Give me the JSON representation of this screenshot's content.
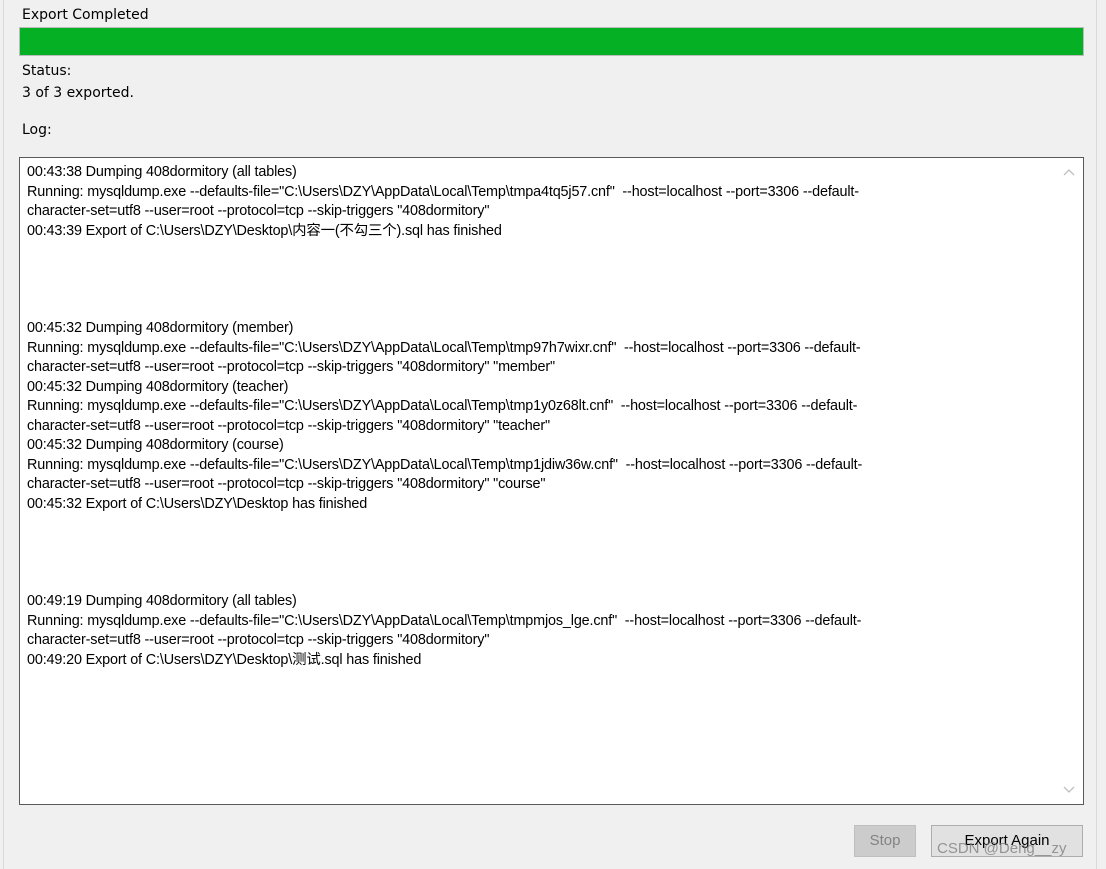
{
  "header": {
    "title": "Export Completed"
  },
  "progress": {
    "fraction": 1.0,
    "color": "#06b025"
  },
  "status": {
    "label": "Status:",
    "value": "3 of 3 exported."
  },
  "log": {
    "label": "Log:",
    "text": "00:43:38 Dumping 408dormitory (all tables)\nRunning: mysqldump.exe --defaults-file=\"C:\\Users\\DZY\\AppData\\Local\\Temp\\tmpa4tq5j57.cnf\"  --host=localhost --port=3306 --default-\ncharacter-set=utf8 --user=root --protocol=tcp --skip-triggers \"408dormitory\"\n00:43:39 Export of C:\\Users\\DZY\\Desktop\\内容一(不勾三个).sql has finished\n\n\n\n\n00:45:32 Dumping 408dormitory (member)\nRunning: mysqldump.exe --defaults-file=\"C:\\Users\\DZY\\AppData\\Local\\Temp\\tmp97h7wixr.cnf\"  --host=localhost --port=3306 --default-\ncharacter-set=utf8 --user=root --protocol=tcp --skip-triggers \"408dormitory\" \"member\"\n00:45:32 Dumping 408dormitory (teacher)\nRunning: mysqldump.exe --defaults-file=\"C:\\Users\\DZY\\AppData\\Local\\Temp\\tmp1y0z68lt.cnf\"  --host=localhost --port=3306 --default-\ncharacter-set=utf8 --user=root --protocol=tcp --skip-triggers \"408dormitory\" \"teacher\"\n00:45:32 Dumping 408dormitory (course)\nRunning: mysqldump.exe --defaults-file=\"C:\\Users\\DZY\\AppData\\Local\\Temp\\tmp1jdiw36w.cnf\"  --host=localhost --port=3306 --default-\ncharacter-set=utf8 --user=root --protocol=tcp --skip-triggers \"408dormitory\" \"course\"\n00:45:32 Export of C:\\Users\\DZY\\Desktop has finished\n\n\n\n\n00:49:19 Dumping 408dormitory (all tables)\nRunning: mysqldump.exe --defaults-file=\"C:\\Users\\DZY\\AppData\\Local\\Temp\\tmpmjos_lge.cnf\"  --host=localhost --port=3306 --default-\ncharacter-set=utf8 --user=root --protocol=tcp --skip-triggers \"408dormitory\"\n00:49:20 Export of C:\\Users\\DZY\\Desktop\\测试.sql has finished"
  },
  "buttons": {
    "stop": "Stop",
    "export_again": "Export Again"
  },
  "scrollbar": {
    "up_icon": "chevron-up-icon",
    "down_icon": "chevron-down-icon"
  },
  "watermark": "CSDN @Deng__zy"
}
